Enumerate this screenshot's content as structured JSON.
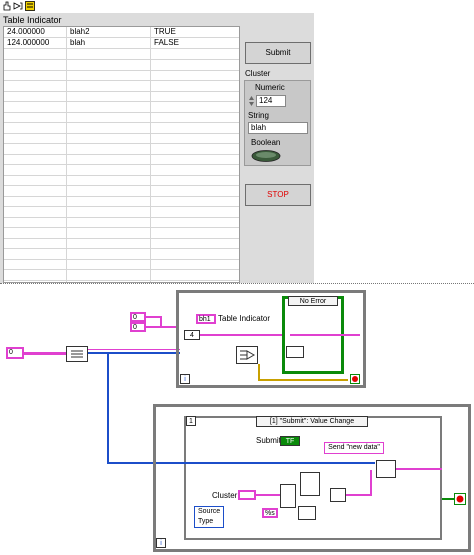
{
  "front_panel": {
    "table_indicator": {
      "caption": "Table Indicator",
      "rows": [
        [
          "24.000000",
          "blah2",
          "TRUE"
        ],
        [
          "124.000000",
          "blah",
          "FALSE"
        ]
      ],
      "empty_row_count": 22
    },
    "submit_button": {
      "label": "Submit"
    },
    "cluster": {
      "caption": "Cluster",
      "numeric": {
        "label": "Numeric",
        "value": "124"
      },
      "string": {
        "label": "String",
        "value": "blah"
      },
      "boolean": {
        "label": "Boolean"
      }
    },
    "stop_button": {
      "label": "STOP"
    }
  },
  "block_diagram": {
    "top_loop": {
      "table_indicator_label": "Table Indicator",
      "case_selector": "No Error",
      "loop_count": "4",
      "array_constant_1": "0",
      "array_constant_2": "0",
      "array_constant_3": "0",
      "string_array_const": "bh1",
      "iteration_terminal": "i"
    },
    "event_structure": {
      "case_selector": "[1] \"Submit\": Value Change",
      "case_index": "1",
      "submit_label": "Submit",
      "submit_terminal": "TF",
      "send_data_const": "Send \"new data\"",
      "cluster_label": "Cluster",
      "percent_s_const": "%s",
      "source_label": "Source",
      "type_label": "Type",
      "iteration_terminal": "i"
    }
  },
  "colors": {
    "panel_bg": "#dcdcdc",
    "string_wire": "#e040d0",
    "refnum_wire": "#1c4ec9",
    "error_wire": "#c8a000",
    "stop_red": "#e00000"
  }
}
